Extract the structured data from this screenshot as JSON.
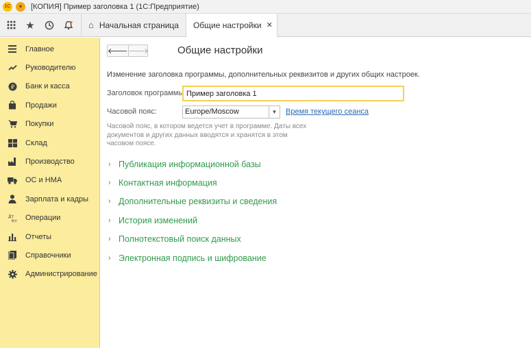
{
  "titlebar": {
    "logo_text": "1С",
    "title": "[КОПИЯ] Пример заголовка 1  (1С:Предприятие)"
  },
  "toolbar": {
    "icons": [
      "apps-grid-icon",
      "star-icon",
      "history-icon",
      "bell-icon"
    ],
    "home_tab": "Начальная страница",
    "active_tab": "Общие настройки",
    "close_glyph": "✕"
  },
  "sidebar": {
    "items": [
      {
        "label": "Главное",
        "icon": "menu-lines-icon"
      },
      {
        "label": "Руководителю",
        "icon": "trend-icon"
      },
      {
        "label": "Банк и касса",
        "icon": "ruble-coin-icon"
      },
      {
        "label": "Продажи",
        "icon": "bag-icon"
      },
      {
        "label": "Покупки",
        "icon": "cart-icon"
      },
      {
        "label": "Склад",
        "icon": "warehouse-icon"
      },
      {
        "label": "Производство",
        "icon": "factory-icon"
      },
      {
        "label": "ОС и НМА",
        "icon": "truck-icon"
      },
      {
        "label": "Зарплата и кадры",
        "icon": "person-icon"
      },
      {
        "label": "Операции",
        "icon": "dt-kt-icon"
      },
      {
        "label": "Отчеты",
        "icon": "bar-chart-icon"
      },
      {
        "label": "Справочники",
        "icon": "books-icon"
      },
      {
        "label": "Администрирование",
        "icon": "gear-icon"
      }
    ]
  },
  "main": {
    "nav_back": "🡐",
    "nav_forward": "🡒",
    "title": "Общие настройки",
    "description": "Изменение заголовка программы, дополнительных реквизитов и других общих настроек.",
    "title_label": "Заголовок программы:",
    "title_value": "Пример заголовка 1",
    "tz_label": "Часовой пояс:",
    "tz_value": "Europe/Moscow",
    "session_link": "Время текущего сеанса",
    "hint_lines": [
      "Часовой пояс, в котором ведется учет в программе. Даты всех",
      "документов и других данных вводятся и хранятся в этом",
      "часовом поясе."
    ],
    "groups": [
      "Публикация информационной базы",
      "Контактная информация",
      "Дополнительные реквизиты и сведения",
      "История изменений",
      "Полнотекстовый поиск данных",
      "Электронная подпись и шифрование"
    ]
  },
  "colors": {
    "sidebar_bg": "#fbec9e",
    "link": "#2a6bb6",
    "group_text": "#2f9a4c",
    "input_focus": "#f2d055"
  }
}
